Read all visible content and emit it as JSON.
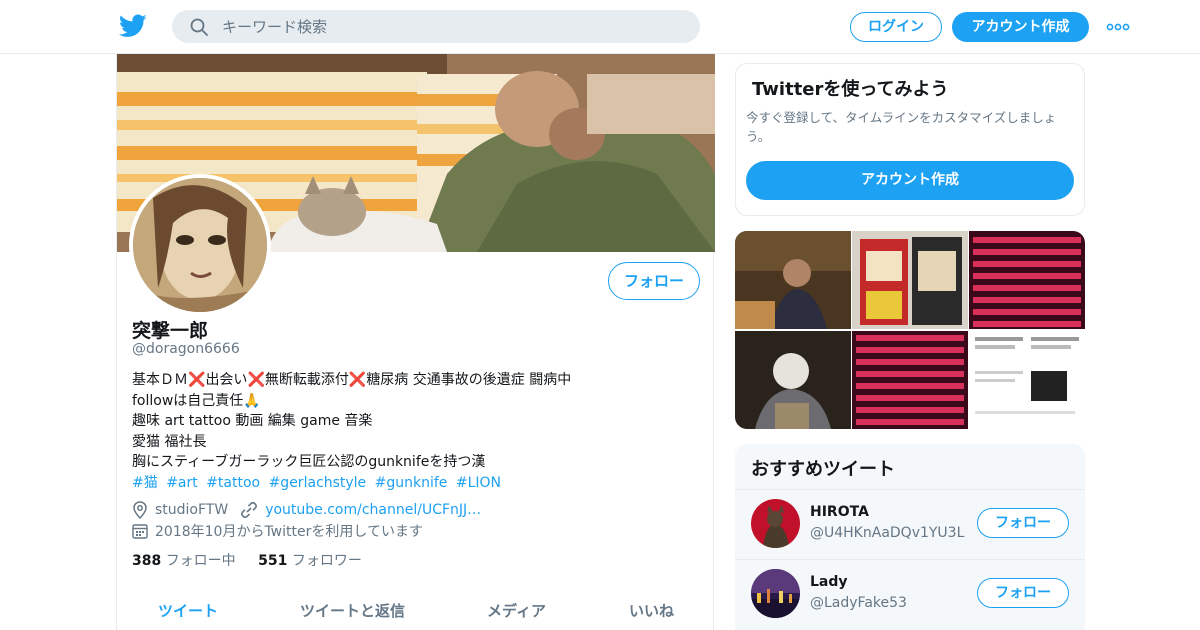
{
  "header": {
    "search_placeholder": "キーワード検索",
    "login_label": "ログイン",
    "signup_label": "アカウント作成"
  },
  "profile": {
    "follow_label": "フォロー",
    "name": "突撃一郎",
    "handle": "@doragon6666",
    "bio": {
      "line1_a": "基本ＤＭ",
      "line1_b": "出会い",
      "line1_c": "無断転載添付",
      "line1_d": "糖尿病 交通事故の後遺症 闘病中",
      "cross": "❌",
      "line2": "followは自己責任🙏",
      "line3": "趣味 art tattoo 動画 編集 game 音楽",
      "line4": "愛猫 福社長",
      "line5": "胸にスティーブガーラック巨匠公認のgunknifeを持つ漢",
      "hashtags": [
        "#猫",
        "#art",
        "#tattoo",
        "#gerlachstyle",
        "#gunknife",
        "#LION"
      ]
    },
    "location": "studioFTW",
    "url": "youtube.com/channel/UCFnJJ…",
    "joined": "2018年10月からTwitterを利用しています",
    "following_count": "388",
    "following_label": "フォロー中",
    "followers_count": "551",
    "followers_label": "フォロワー"
  },
  "tabs": [
    "ツイート",
    "ツイートと返信",
    "メディア",
    "いいね"
  ],
  "signup_card": {
    "title": "Twitterを使ってみよう",
    "text": "今すぐ登録して、タイムラインをカスタマイズしましょう。",
    "button": "アカウント作成"
  },
  "recommendations": {
    "title": "おすすめツイート",
    "items": [
      {
        "name": "HIROTA",
        "handle": "@U4HKnAaDQv1YU3L",
        "button": "フォロー"
      },
      {
        "name": "Lady",
        "handle": "@LadyFake53",
        "button": "フォロー"
      }
    ]
  },
  "colors": {
    "accent": "#1da1f2",
    "text": "#14171a",
    "secondary": "#657786",
    "cross": "#e0245e"
  },
  "icons": [
    "twitter-bird-icon",
    "search-icon",
    "more-dots-icon",
    "location-icon",
    "link-icon",
    "calendar-icon"
  ]
}
